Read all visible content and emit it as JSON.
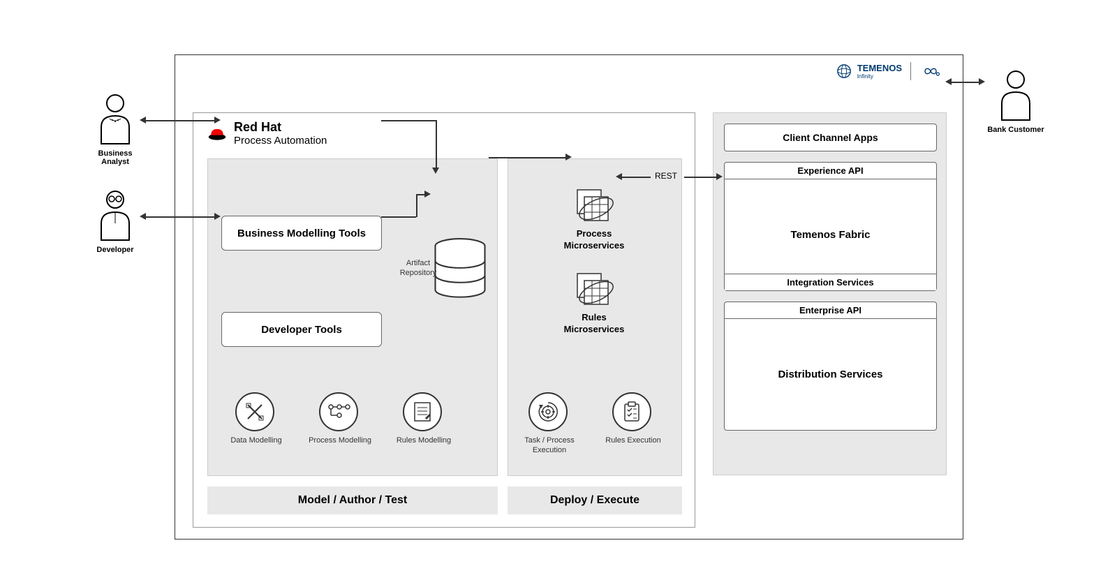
{
  "logo": {
    "temenos": "TEMENOS",
    "temenos_sub": "Infinity"
  },
  "redhat": {
    "brand": "Red Hat",
    "product": "Process Automation"
  },
  "actors": {
    "business_analyst": "Business Analyst",
    "developer": "Developer",
    "bank_customer": "Bank Customer"
  },
  "tools": {
    "business_modelling": "Business Modelling Tools",
    "developer_tools": "Developer Tools"
  },
  "repo_label": "Artifact Repository",
  "microservices": {
    "process": "Process Microservices",
    "rules": "Rules Microservices"
  },
  "circles": {
    "data_modelling": "Data Modelling",
    "process_modelling": "Process Modelling",
    "rules_modelling": "Rules Modelling",
    "task_process_execution": "Task / Process Execution",
    "rules_execution": "Rules Execution"
  },
  "phases": {
    "model": "Model / Author / Test",
    "deploy": "Deploy / Execute"
  },
  "services": {
    "client_channel_apps": "Client Channel Apps",
    "experience_api": "Experience API",
    "temenos_fabric": "Temenos Fabric",
    "integration_services": "Integration Services",
    "enterprise_api": "Enterprise API",
    "distribution_services": "Distribution Services"
  },
  "rest_label": "REST"
}
